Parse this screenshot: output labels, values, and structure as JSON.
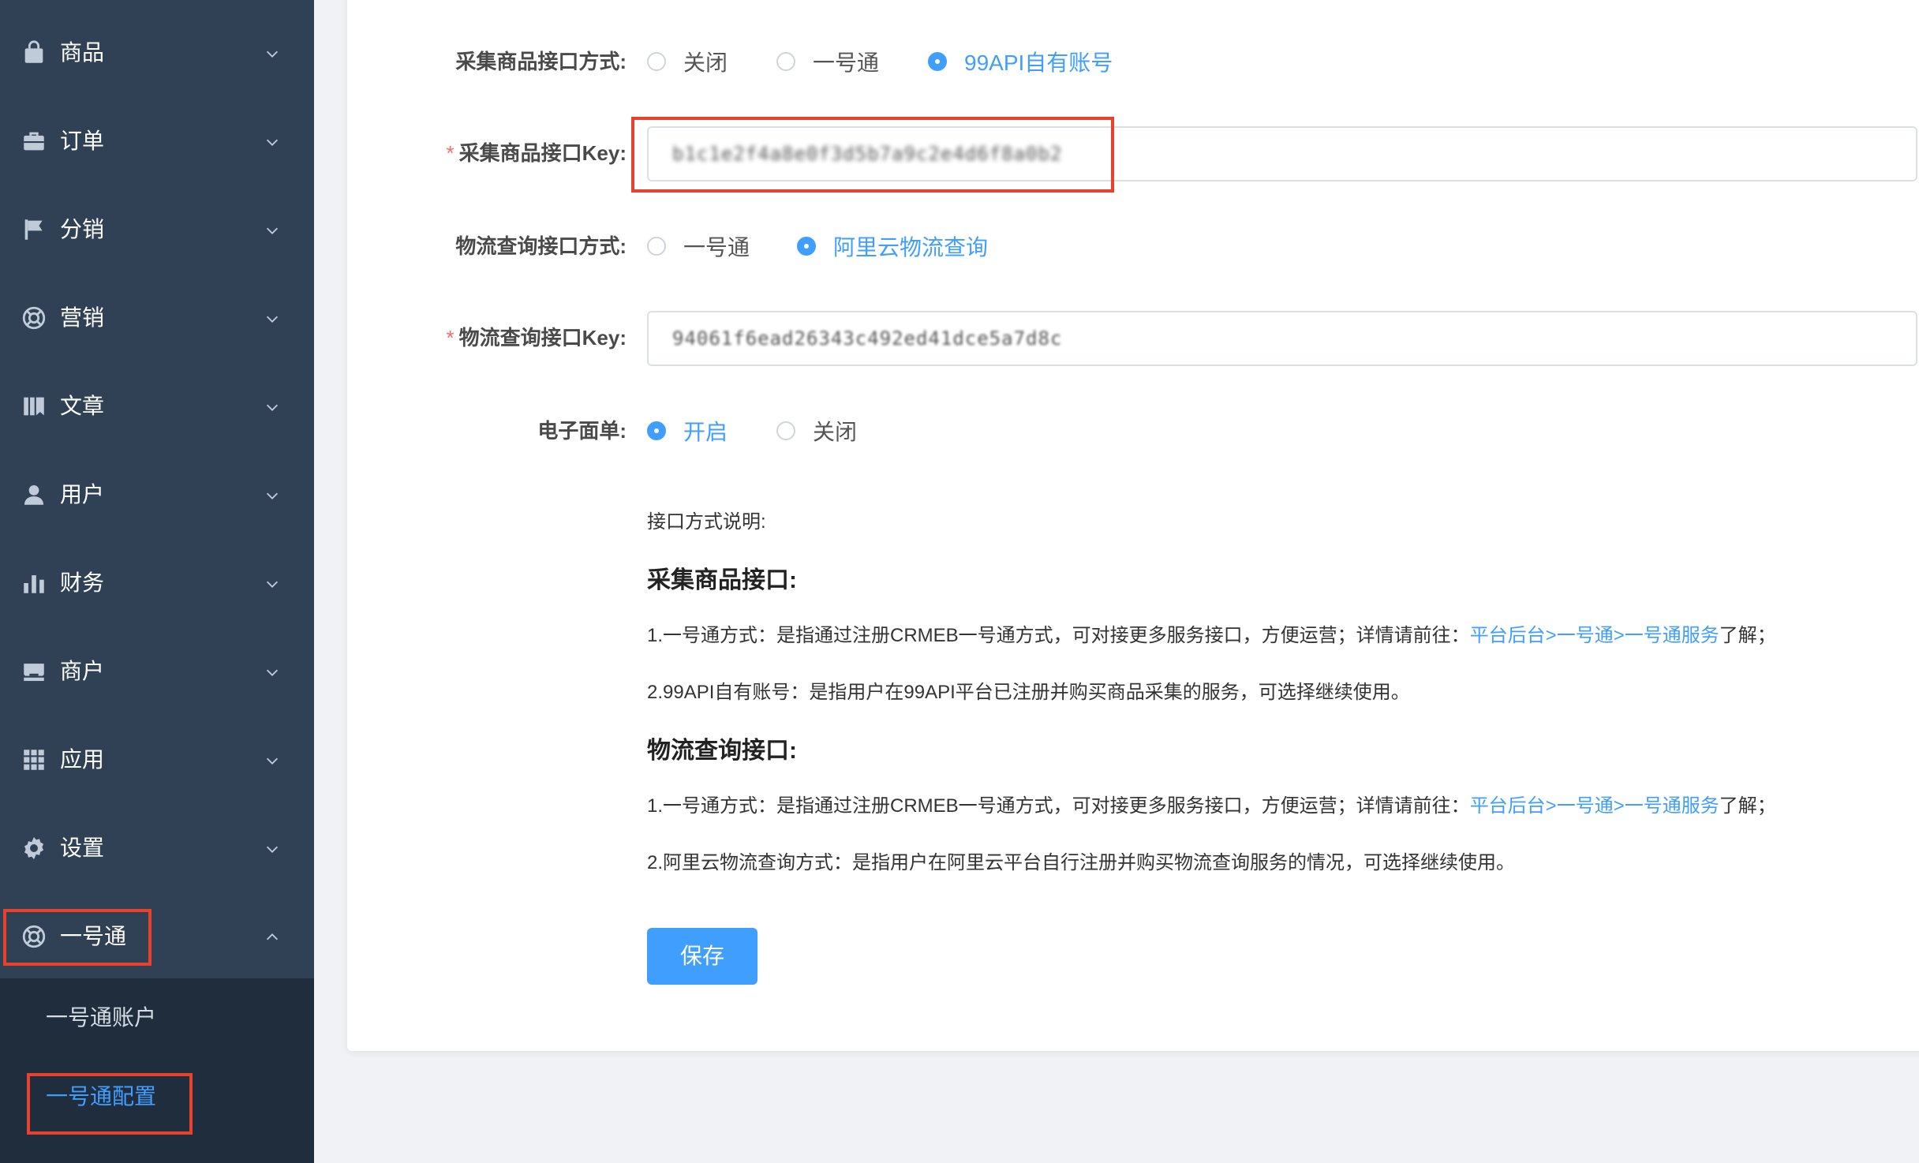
{
  "sidebar": {
    "items": [
      {
        "label": "商品",
        "icon": "shopping-bag-icon"
      },
      {
        "label": "订单",
        "icon": "briefcase-icon"
      },
      {
        "label": "分销",
        "icon": "flag-icon"
      },
      {
        "label": "营销",
        "icon": "lifebuoy-icon"
      },
      {
        "label": "文章",
        "icon": "books-icon"
      },
      {
        "label": "用户",
        "icon": "user-icon"
      },
      {
        "label": "财务",
        "icon": "bar-chart-icon"
      },
      {
        "label": "商户",
        "icon": "store-icon"
      },
      {
        "label": "应用",
        "icon": "grid-icon"
      },
      {
        "label": "设置",
        "icon": "gear-icon"
      },
      {
        "label": "一号通",
        "icon": "lifebuoy-icon",
        "expanded": true
      }
    ],
    "submenu": [
      {
        "label": "一号通账户"
      },
      {
        "label": "一号通配置",
        "active": true
      }
    ]
  },
  "form": {
    "collect_mode": {
      "label": "采集商品接口方式:",
      "options": [
        "关闭",
        "一号通",
        "99API自有账号"
      ],
      "selected": "99API自有账号"
    },
    "collect_key": {
      "label": "采集商品接口Key:",
      "required": true,
      "value": "b1c1e2f4a8e0f3d5b7a9c2e4d6f8a0b2"
    },
    "logistics_mode": {
      "label": "物流查询接口方式:",
      "options": [
        "一号通",
        "阿里云物流查询"
      ],
      "selected": "阿里云物流查询"
    },
    "logistics_key": {
      "label": "物流查询接口Key:",
      "required": true,
      "value": "94061f6ead26343c492ed41dce5a7d8c"
    },
    "e_waybill": {
      "label": "电子面单:",
      "options": [
        "开启",
        "关闭"
      ],
      "selected": "开启"
    }
  },
  "description": {
    "intro": "接口方式说明:",
    "collect_title": "采集商品接口:",
    "collect_line1_prefix": "1.一号通方式：是指通过注册CRMEB一号通方式，可对接更多服务接口，方便运营；详情请前往：",
    "collect_line1_link": "平台后台>一号通>一号通服务",
    "collect_line1_suffix": "了解；",
    "collect_line2": "2.99API自有账号：是指用户在99API平台已注册并购买商品采集的服务，可选择继续使用。",
    "logistics_title": "物流查询接口:",
    "logistics_line1_prefix": "1.一号通方式：是指通过注册CRMEB一号通方式，可对接更多服务接口，方便运营；详情请前往：",
    "logistics_line1_link": "平台后台>一号通>一号通服务",
    "logistics_line1_suffix": "了解；",
    "logistics_line2": "2.阿里云物流查询方式：是指用户在阿里云平台自行注册并购买物流查询服务的情况，可选择继续使用。"
  },
  "actions": {
    "save_label": "保存"
  },
  "colors": {
    "sidebar_bg": "#304156",
    "submenu_bg": "#1f2d3d",
    "accent": "#409eff",
    "highlight": "#e8412d",
    "required": "#f56c6c"
  }
}
